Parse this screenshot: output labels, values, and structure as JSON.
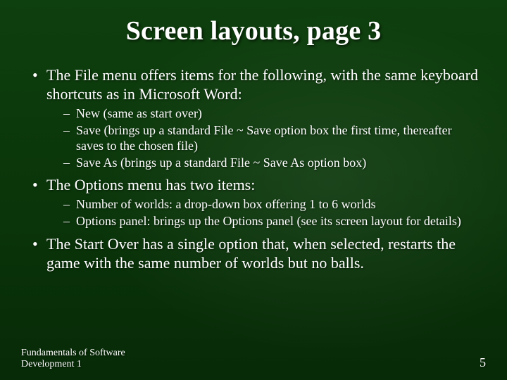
{
  "title": "Screen layouts, page 3",
  "bullets": [
    {
      "text": "The File menu offers items for the following, with the same keyboard shortcuts as in Microsoft Word:",
      "sub": [
        "New (same as start over)",
        "Save (brings up a standard File ~ Save option box the first time, thereafter saves to the chosen file)",
        "Save As (brings up a standard File ~ Save As option box)"
      ]
    },
    {
      "text": "The Options menu has two items:",
      "sub": [
        "Number of worlds:  a drop-down box offering 1 to 6 worlds",
        "Options panel:  brings up the Options panel (see its screen layout for details)"
      ]
    },
    {
      "text": "The Start Over has a single option that, when selected, restarts the game with the same number of worlds but no balls.",
      "sub": []
    }
  ],
  "footer_left": "Fundamentals of Software Development 1",
  "page_number": "5"
}
